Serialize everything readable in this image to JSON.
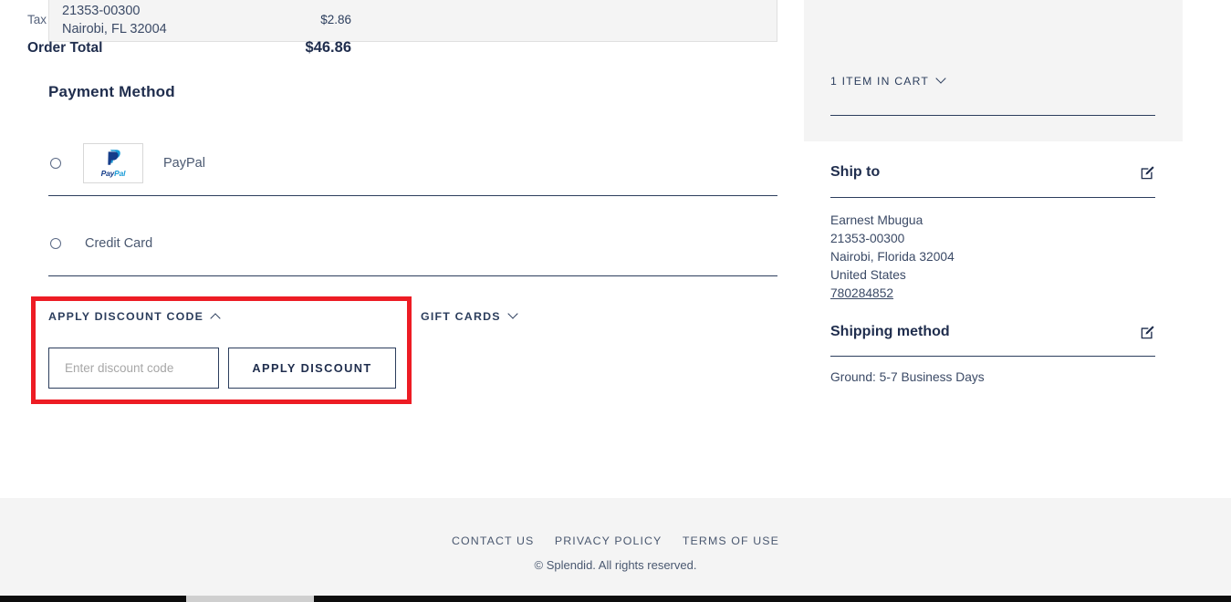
{
  "checkout": {
    "shipping_address_box": {
      "lines": [
        "21353-00300",
        "Nairobi, FL 32004"
      ]
    },
    "payment": {
      "title": "Payment Method",
      "options": [
        {
          "label": "PayPal",
          "logo_word_a": "Pay",
          "logo_word_b": "Pal",
          "selected": false
        },
        {
          "label": "Credit Card",
          "selected": false
        }
      ]
    },
    "discount": {
      "heading": "APPLY DISCOUNT CODE",
      "expanded": true,
      "input_placeholder": "Enter discount code",
      "input_value": "",
      "apply_button": "APPLY DISCOUNT",
      "highlight_color": "#ed1c24"
    },
    "gift_cards": {
      "heading": "GIFT CARDS",
      "expanded": false
    }
  },
  "summary": {
    "tax_label": "Tax",
    "tax_value": "$2.86",
    "order_total_label": "Order Total",
    "order_total_value": "$46.86",
    "cart_toggle_label": "1 ITEM IN CART",
    "ship_to": {
      "heading": "Ship to",
      "name": "Earnest Mbugua",
      "postal": "21353-00300",
      "city_state_zip": "Nairobi, Florida 32004",
      "country": "United States",
      "phone": "780284852"
    },
    "shipping_method": {
      "heading": "Shipping method",
      "value": "Ground: 5-7 Business Days"
    }
  },
  "footer": {
    "links": [
      "CONTACT US",
      "PRIVACY POLICY",
      "TERMS OF USE"
    ],
    "copyright": "© Splendid. All rights reserved."
  }
}
